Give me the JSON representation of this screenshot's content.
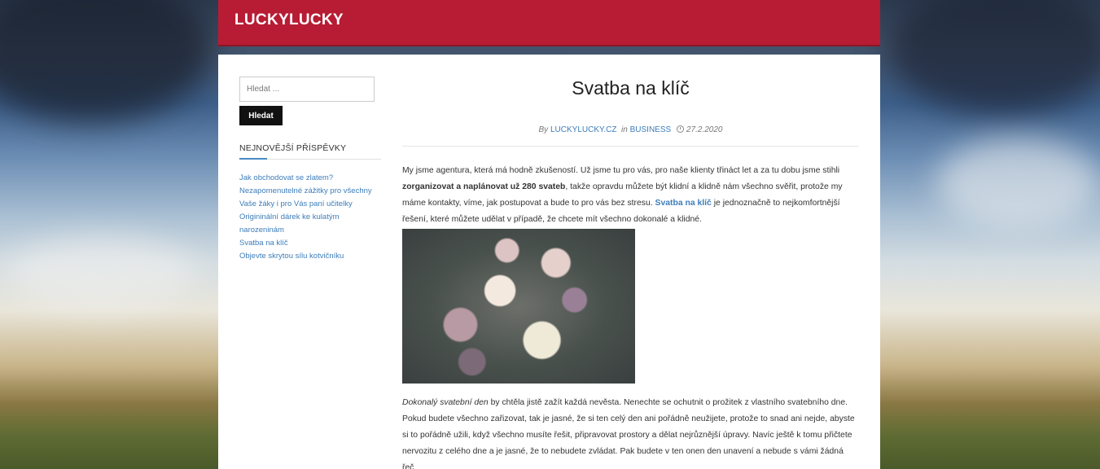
{
  "site": {
    "title": "LUCKYLUCKY"
  },
  "sidebar": {
    "search_placeholder": "Hledat ...",
    "search_button": "Hledat",
    "recent_title": "NEJNOVĚJŠÍ PŘÍSPĚVKY",
    "recent_posts": [
      "Jak obchodovat se zlatem?",
      "Nezapomenutelné zážitky pro všechny",
      "Vaše žáky i pro Vás paní učitelky",
      "Origininální dárek ke kulatým narozeninám",
      "Svatba na klíč",
      "Objevte skrytou sílu kotvičníku"
    ]
  },
  "article": {
    "title": "Svatba na klíč",
    "meta": {
      "by": "By",
      "author": "LUCKYLUCKY.CZ",
      "in": "in",
      "category": "BUSINESS",
      "date": "27.2.2020"
    },
    "p1": {
      "text_a": "My jsme agentura, která má hodně zkušeností. Už jsme tu pro vás, pro naše klienty třináct let a za tu dobu jsme stihli ",
      "bold": "zorganizovat a naplánovat už 280 svateb",
      "text_b": ", takže opravdu můžete být klidní a klidně nám všechno svěřit, protože my máme kontakty, víme, jak postupovat a bude to pro vás bez stresu. ",
      "link": "Svatba na klíč",
      "text_c": " je jednoznačně to nejkomfortnější řešení, které můžete udělat v případě, že chcete mít všechno dokonalé a klidné."
    },
    "p2": {
      "italic": "Dokonalý svatební den",
      "text": " by chtěla jistě zažít každá nevěsta. Nenechte se ochutnit o prožitek z vlastního svatebního dne. Pokud budete všechno zařizovat, tak je jasné, že si ten celý den ani pořádně neužijete, protože to snad ani nejde, abyste si to pořádně užili, když všechno musíte řešit, připravovat prostory a dělat nejrůznější úpravy. Navíc ještě k tomu přičtete nervozitu z celého dne a je jasné, že to nebudete zvládat. Pak budete v ten onen den unavení a nebude s vámi žádná řeč."
    }
  }
}
